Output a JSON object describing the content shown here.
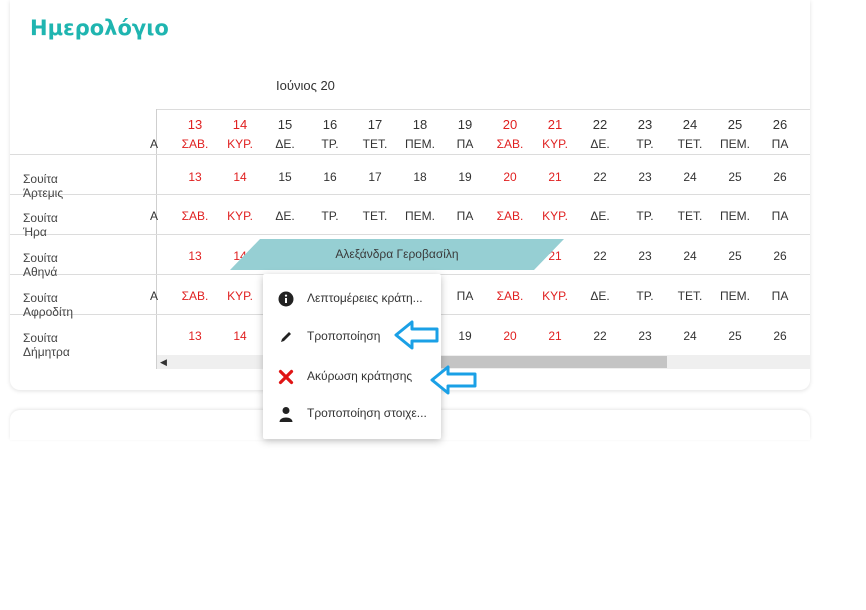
{
  "page_title": "Ημερολόγιο",
  "month_label": "Ιούνιος 20",
  "partial_day": "Α",
  "days": [
    {
      "num": "13",
      "abbr": "ΣΑΒ.",
      "weekend": true
    },
    {
      "num": "14",
      "abbr": "ΚΥΡ.",
      "weekend": true
    },
    {
      "num": "15",
      "abbr": "ΔΕ.",
      "weekend": false
    },
    {
      "num": "16",
      "abbr": "ΤΡ.",
      "weekend": false
    },
    {
      "num": "17",
      "abbr": "ΤΕΤ.",
      "weekend": false
    },
    {
      "num": "18",
      "abbr": "ΠΕΜ.",
      "weekend": false
    },
    {
      "num": "19",
      "abbr": "ΠΑ",
      "weekend": false
    },
    {
      "num": "20",
      "abbr": "ΣΑΒ.",
      "weekend": true
    },
    {
      "num": "21",
      "abbr": "ΚΥΡ.",
      "weekend": true
    },
    {
      "num": "22",
      "abbr": "ΔΕ.",
      "weekend": false
    },
    {
      "num": "23",
      "abbr": "ΤΡ.",
      "weekend": false
    },
    {
      "num": "24",
      "abbr": "ΤΕΤ.",
      "weekend": false
    },
    {
      "num": "25",
      "abbr": "ΠΕΜ.",
      "weekend": false
    },
    {
      "num": "26",
      "abbr": "ΠΑ",
      "weekend": false
    }
  ],
  "rooms": [
    {
      "name": "Σουίτα Άρτεμις",
      "mode": "num"
    },
    {
      "name": "Σουίτα Ήρα",
      "mode": "abbr"
    },
    {
      "name": "Σουίτα Αθηνά",
      "mode": "num"
    },
    {
      "name": "Σουίτα Αφροδίτη",
      "mode": "abbr"
    },
    {
      "name": "Σουίτα Δήμητρα",
      "mode": "num"
    }
  ],
  "booking": {
    "guest": "Αλεξάνδρα Γεροβασίλη"
  },
  "context_menu": {
    "items": [
      {
        "label": "Λεπτομέρειες κράτη...",
        "icon": "info-icon"
      },
      {
        "label": "Τροποποίηση",
        "icon": "pencil-icon"
      },
      {
        "label": "Ακύρωση κράτησης",
        "icon": "cancel-x-icon"
      },
      {
        "label": "Τροποποίηση στοιχε...",
        "icon": "person-icon"
      }
    ]
  },
  "colors": {
    "accent": "#1fb5b0",
    "weekend": "#e02020",
    "booking": "#96cfd3",
    "arrow": "#1aa0e6"
  }
}
